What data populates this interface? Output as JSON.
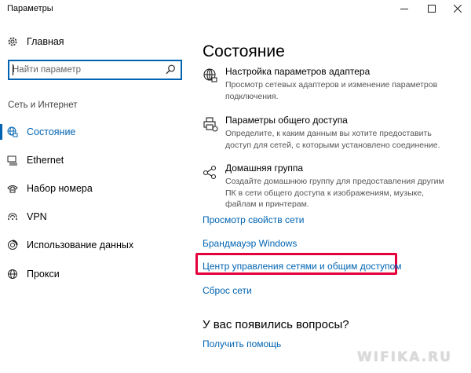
{
  "window": {
    "title": "Параметры"
  },
  "sidebar": {
    "home_label": "Главная",
    "search_placeholder": "Найти параметр",
    "section_label": "Сеть и Интернет",
    "items": [
      {
        "label": "Состояние",
        "icon": "globe-status-icon",
        "active": true
      },
      {
        "label": "Ethernet",
        "icon": "ethernet-icon"
      },
      {
        "label": "Набор номера",
        "icon": "dialup-icon"
      },
      {
        "label": "VPN",
        "icon": "vpn-icon"
      },
      {
        "label": "Использование данных",
        "icon": "data-usage-icon"
      },
      {
        "label": "Прокси",
        "icon": "proxy-globe-icon"
      }
    ]
  },
  "main": {
    "title": "Состояние",
    "blocks": [
      {
        "icon": "globe-icon",
        "title": "Настройка параметров адаптера",
        "description": "Просмотр сетевых адаптеров и изменение параметров подключения."
      },
      {
        "icon": "printer-share-icon",
        "title": "Параметры общего доступа",
        "description": "Определите, к каким данным вы хотите предоставить доступ для сетей, с которыми установлено соединение."
      },
      {
        "icon": "homegroup-icon",
        "title": "Домашняя группа",
        "description": "Создайте домашнюю группу для предоставления другим ПК в сети общего доступа к изображениям, музыке, файлам и принтерам."
      }
    ],
    "links": [
      "Просмотр свойств сети",
      "Брандмауэр Windows",
      "Центр управления сетями и общим доступом",
      "Сброс сети"
    ],
    "questions_title": "У вас появились вопросы?",
    "help_link": "Получить помощь"
  },
  "colors": {
    "accent": "#0063b1",
    "highlight_frame": "#e4003b"
  },
  "watermark": "WIFIKA.RU"
}
